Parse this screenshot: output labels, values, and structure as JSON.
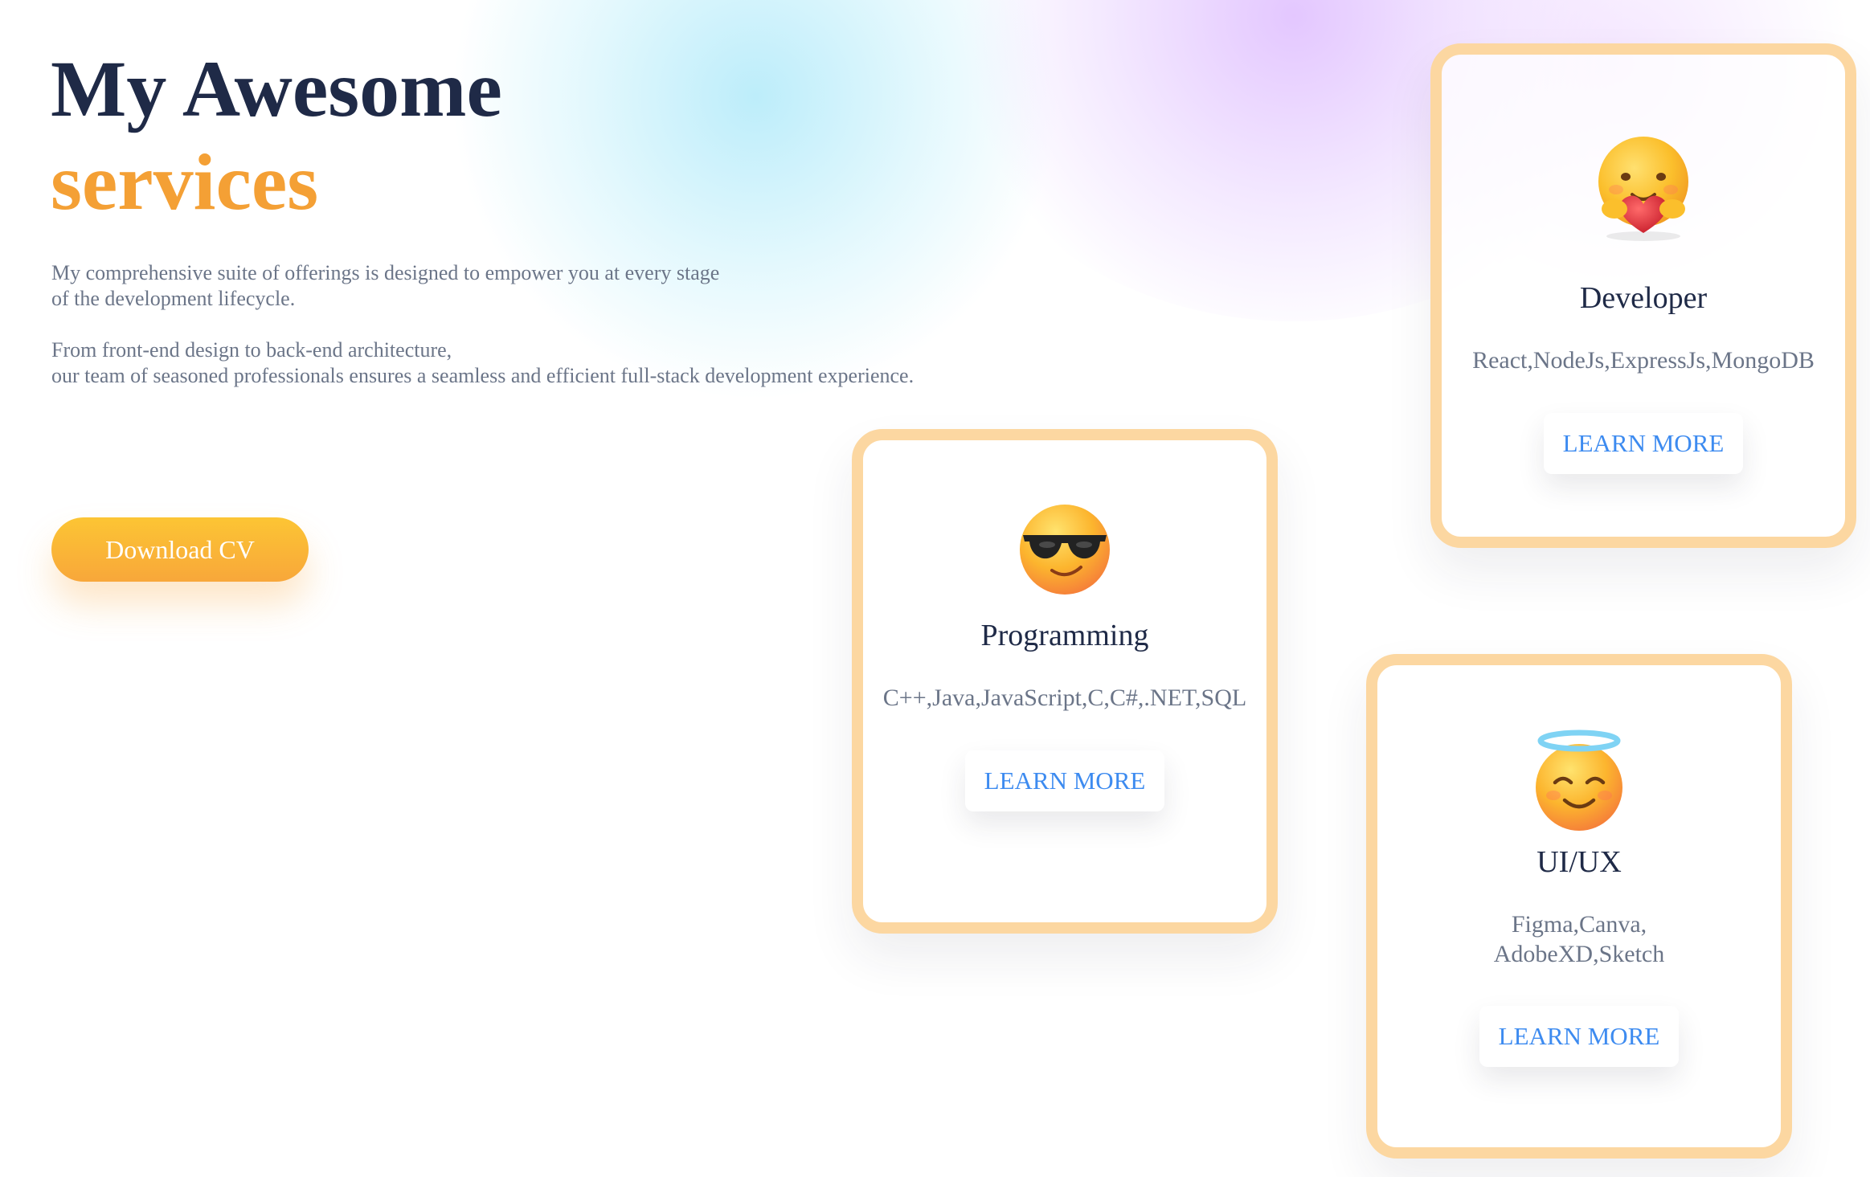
{
  "hero": {
    "title_line1": "My Awesome",
    "title_line2": "services",
    "description": [
      "My comprehensive suite of offerings is designed to empower you at every stage",
      "of the development lifecycle.",
      "From front-end design to back-end architecture,",
      "our team of seasoned professionals ensures a seamless and efficient full-stack development experience."
    ],
    "download_label": "Download CV"
  },
  "colors": {
    "heading": "#1f2a47",
    "accent_orange": "#f4a035",
    "body_text": "#6b7588",
    "card_border": "#fcd7a1",
    "link_blue": "#3d8bf0"
  },
  "cards": [
    {
      "icon": "hugging-face-emoji-icon",
      "title": "Developer",
      "skills": "React,NodeJs,ExpressJs,MongoDB",
      "button_label": "LEARN MORE"
    },
    {
      "icon": "sunglasses-face-emoji-icon",
      "title": "Programming",
      "skills": "C++,Java,JavaScript,C,C#,.NET,SQL",
      "button_label": "LEARN MORE"
    },
    {
      "icon": "halo-face-emoji-icon",
      "title": "UI/UX",
      "skills": "Figma,Canva,\nAdobeXD,Sketch",
      "button_label": "LEARN MORE"
    }
  ]
}
